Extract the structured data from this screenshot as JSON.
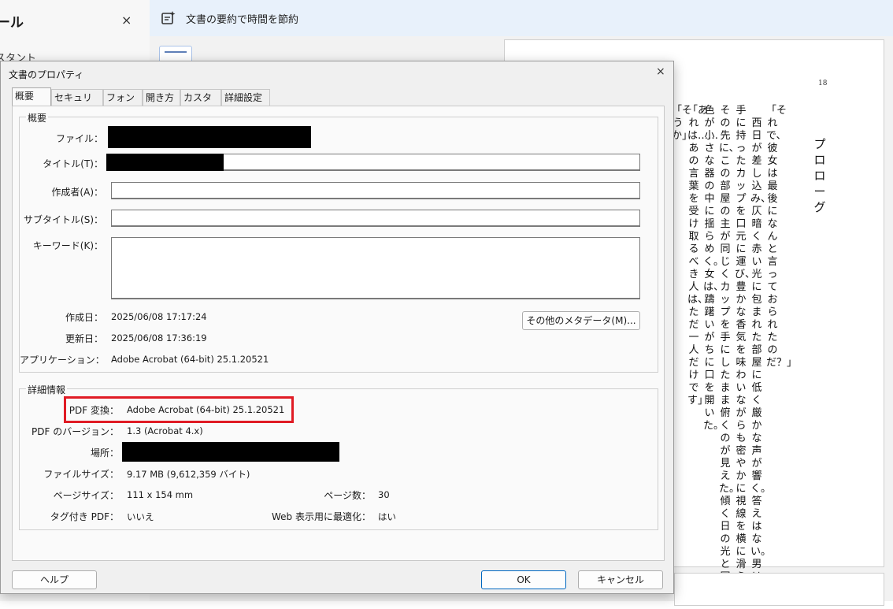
{
  "left_panel": {
    "title": "ール",
    "close": "×",
    "subtitle": "スタント"
  },
  "banner": {
    "text": "文書の要約で時間を節約",
    "icon": "summary-icon"
  },
  "document_page": {
    "page_number": "18",
    "heading": "プロローグ",
    "lines": [
      "「それで、彼女は最後になんと言っておられたのだ？」",
      "　西日が差し込み、仄暗く赤い光に包まれた部屋に低く厳かな声が響く。答えはない。男は",
      "手に持ったカップを口元に運び、豊かな香気を味わいながらも密やかに視線を横に滑らせる。",
      "その先に、この部屋の主が同じくカップを手にしたまま俯くのが見えた。傾く日の光と同じ",
      "色が小さな器の中に揺らめく。女は、躊躇いがちに口を開いた。",
      "「あれは……あの言葉を受け取るべき人は、ただ一人だけです」",
      "「そうか」"
    ]
  },
  "dialog": {
    "title": "文書のプロパティ",
    "close": "×",
    "tabs": [
      "概要",
      "セキュリティ",
      "フォント",
      "開き方",
      "カスタム",
      "詳細設定"
    ],
    "summary_group": {
      "label": "概要",
      "file_label": "ファイル：",
      "title_label": "タイトル(T)：",
      "author_label": "作成者(A)：",
      "author_value": "",
      "subtitle_label": "サブタイトル(S)：",
      "subtitle_value": "",
      "keywords_label": "キーワード(K)：",
      "keywords_value": "",
      "created_label": "作成日：",
      "created_value": "2025/06/08 17:17:24",
      "modified_label": "更新日：",
      "modified_value": "2025/06/08 17:36:19",
      "application_label": "アプリケーション：",
      "application_value": "Adobe Acrobat (64-bit) 25.1.20521",
      "more_metadata_button": "その他のメタデータ(M)..."
    },
    "details_group": {
      "label": "詳細情報",
      "producer_label": "PDF 変換：",
      "producer_value": "Adobe Acrobat (64-bit) 25.1.20521",
      "version_label": "PDF のバージョン：",
      "version_value": "1.3 (Acrobat 4.x)",
      "location_label": "場所：",
      "filesize_label": "ファイルサイズ：",
      "filesize_value": "9.17 MB (9,612,359 バイト)",
      "pagesize_label": "ページサイズ：",
      "pagesize_value": "111 x 154 mm",
      "pages_label": "ページ数：",
      "pages_value": "30",
      "tagged_label": "タグ付き PDF：",
      "tagged_value": "いいえ",
      "fastweb_label": "Web 表示用に最適化：",
      "fastweb_value": "はい"
    },
    "buttons": {
      "help": "ヘルプ",
      "ok": "OK",
      "cancel": "キャンセル"
    }
  },
  "colors": {
    "highlight": "#e01b24",
    "banner_bg": "#e8f1fb",
    "primary_border": "#0067c0"
  }
}
